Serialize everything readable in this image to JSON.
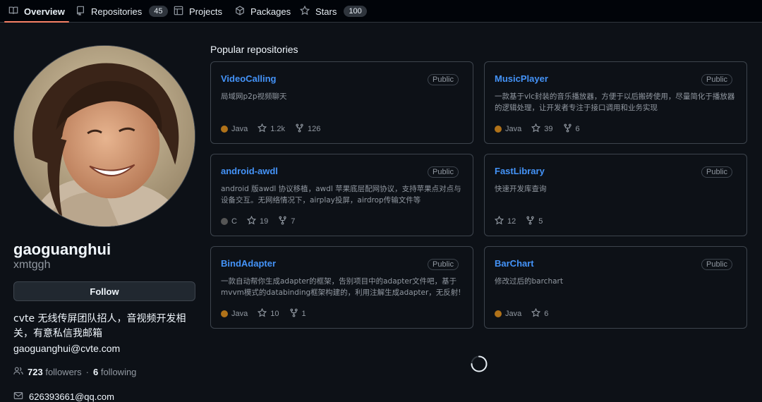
{
  "tabs": [
    {
      "label": "Overview",
      "icon": "book-icon",
      "active": true
    },
    {
      "label": "Repositories",
      "icon": "repo-icon",
      "count": "45"
    },
    {
      "label": "Projects",
      "icon": "table-icon"
    },
    {
      "label": "Packages",
      "icon": "package-icon"
    },
    {
      "label": "Stars",
      "icon": "star-icon",
      "count": "100"
    }
  ],
  "profile": {
    "name": "gaoguanghui",
    "login": "xmtggh",
    "follow_label": "Follow",
    "bio": "cvte 无线传屏团队招人，音视频开发相关，有意私信我邮箱",
    "bio_email": "gaoguanghui@cvte.com",
    "followers_count": "723",
    "followers_label": "followers",
    "separator": "·",
    "following_count": "6",
    "following_label": "following",
    "contact_email": "626393661@qq.com"
  },
  "section_title": "Popular repositories",
  "repos": [
    {
      "name": "VideoCalling",
      "visibility": "Public",
      "desc": "局域网p2p视频聊天",
      "lang": "Java",
      "lang_color": "#b07219",
      "stars": "1.2k",
      "forks": "126"
    },
    {
      "name": "MusicPlayer",
      "visibility": "Public",
      "desc": "一款基于vlc封装的音乐播放器，方便于以后搬砖使用，尽量简化于播放器的逻辑处理，让开发者专注于接口调用和业务实现",
      "lang": "Java",
      "lang_color": "#b07219",
      "stars": "39",
      "forks": "6"
    },
    {
      "name": "android-awdl",
      "visibility": "Public",
      "desc": "android 版awdl 协议移植，awdl 苹果底层配网协议，支持苹果点对点与设备交互。无网络情况下，airplay投屏，airdrop传输文件等",
      "lang": "C",
      "lang_color": "#555555",
      "stars": "19",
      "forks": "7"
    },
    {
      "name": "FastLibrary",
      "visibility": "Public",
      "desc": "快速开发库查询",
      "lang": "",
      "lang_color": "",
      "stars": "12",
      "forks": "5"
    },
    {
      "name": "BindAdapter",
      "visibility": "Public",
      "desc": "一款自动帮你生成adapter的框架，告别项目中的adapter文件吧，基于mvvm模式的databinding框架构建的，利用注解生成adapter，无反射!",
      "lang": "Java",
      "lang_color": "#b07219",
      "stars": "10",
      "forks": "1"
    },
    {
      "name": "BarChart",
      "visibility": "Public",
      "desc": "修改过后的barchart",
      "lang": "Java",
      "lang_color": "#b07219",
      "stars": "6",
      "forks": ""
    }
  ],
  "colors": {
    "accent_link": "#4493f8",
    "active_tab_underline": "#f78166",
    "background": "#0d1117"
  }
}
